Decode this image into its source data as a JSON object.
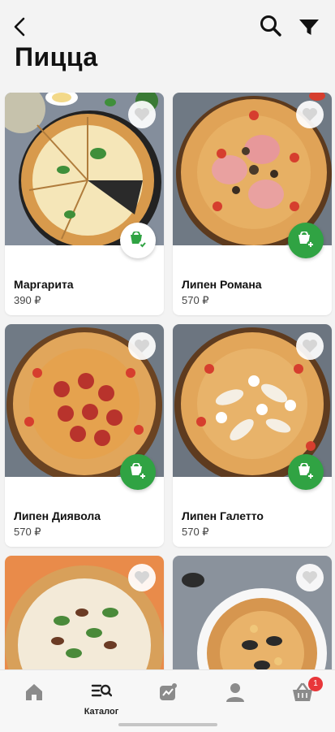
{
  "header": {
    "title": "Пицца"
  },
  "products": [
    {
      "name": "Маргарита",
      "price": "390 ₽",
      "in_cart": true
    },
    {
      "name": "Липен Романа",
      "price": "570 ₽",
      "in_cart": false
    },
    {
      "name": "Липен Диявола",
      "price": "570 ₽",
      "in_cart": false
    },
    {
      "name": "Липен Галетто",
      "price": "570 ₽",
      "in_cart": false
    },
    {
      "name": "",
      "price": "",
      "in_cart": false
    },
    {
      "name": "",
      "price": "",
      "in_cart": false
    }
  ],
  "nav": {
    "items": [
      {
        "icon": "home-icon",
        "label": ""
      },
      {
        "icon": "catalog-icon",
        "label": "Каталог"
      },
      {
        "icon": "trending-icon",
        "label": ""
      },
      {
        "icon": "profile-icon",
        "label": ""
      },
      {
        "icon": "basket-icon",
        "label": ""
      }
    ],
    "cart_badge": "1"
  },
  "colors": {
    "accent": "#30a343",
    "badge": "#e8373a",
    "background": "#f3f3f3"
  }
}
